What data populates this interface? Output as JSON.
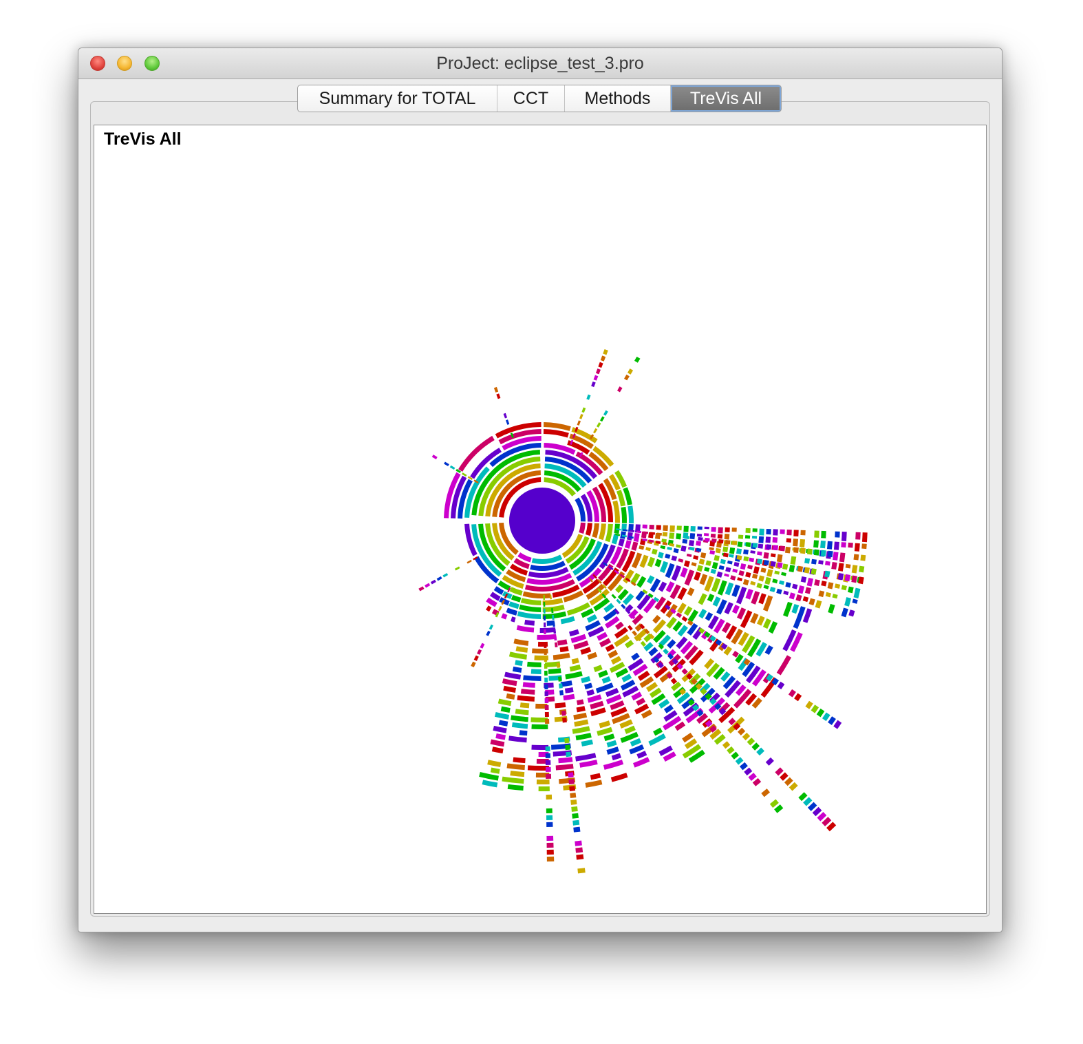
{
  "window": {
    "title": "ProJect: eclipse_test_3.pro"
  },
  "tabs": [
    {
      "label": "Summary for TOTAL",
      "active": false
    },
    {
      "label": "CCT",
      "active": false
    },
    {
      "label": "Methods",
      "active": false
    },
    {
      "label": "TreVis All",
      "active": true
    }
  ],
  "view": {
    "title": "TreVis All"
  },
  "visualization": {
    "type": "sunburst-tree",
    "root_color": "#5500cc",
    "palette": [
      "#cc0000",
      "#cc6600",
      "#ccaa00",
      "#88cc00",
      "#00bb00",
      "#00bbbb",
      "#0033cc",
      "#6600cc",
      "#cc00cc",
      "#cc0066"
    ]
  }
}
